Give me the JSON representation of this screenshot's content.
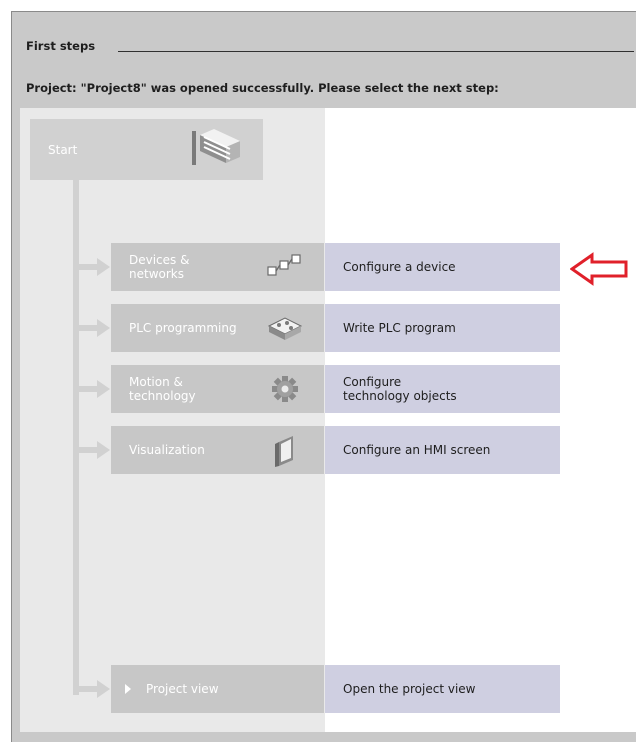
{
  "header": {
    "section_title": "First steps",
    "subtitle": "Project: \"Project8\" was opened successfully. Please select the next step:"
  },
  "start": {
    "label": "Start",
    "icon": "start-portal-icon"
  },
  "steps": [
    {
      "label": "Devices &\nnetworks",
      "action": "Configure a device",
      "icon": "devices-networks-icon",
      "highlighted": true
    },
    {
      "label": "PLC programming",
      "action": "Write PLC program",
      "icon": "plc-programming-icon"
    },
    {
      "label": "Motion &\ntechnology",
      "action": "Configure\ntechnology objects",
      "icon": "motion-gear-icon"
    },
    {
      "label": "Visualization",
      "action": "Configure an HMI screen",
      "icon": "hmi-panel-icon"
    }
  ],
  "project_view": {
    "label": "Project view",
    "action": "Open the project view",
    "icon": "caret-right-icon"
  },
  "annotation": {
    "icon": "red-arrow-left-icon",
    "color": "#e0202a"
  },
  "colors": {
    "panel_gray": "#c9c9c9",
    "step_gray": "#c7c7c7",
    "action_lavender": "#cfcfe1"
  }
}
